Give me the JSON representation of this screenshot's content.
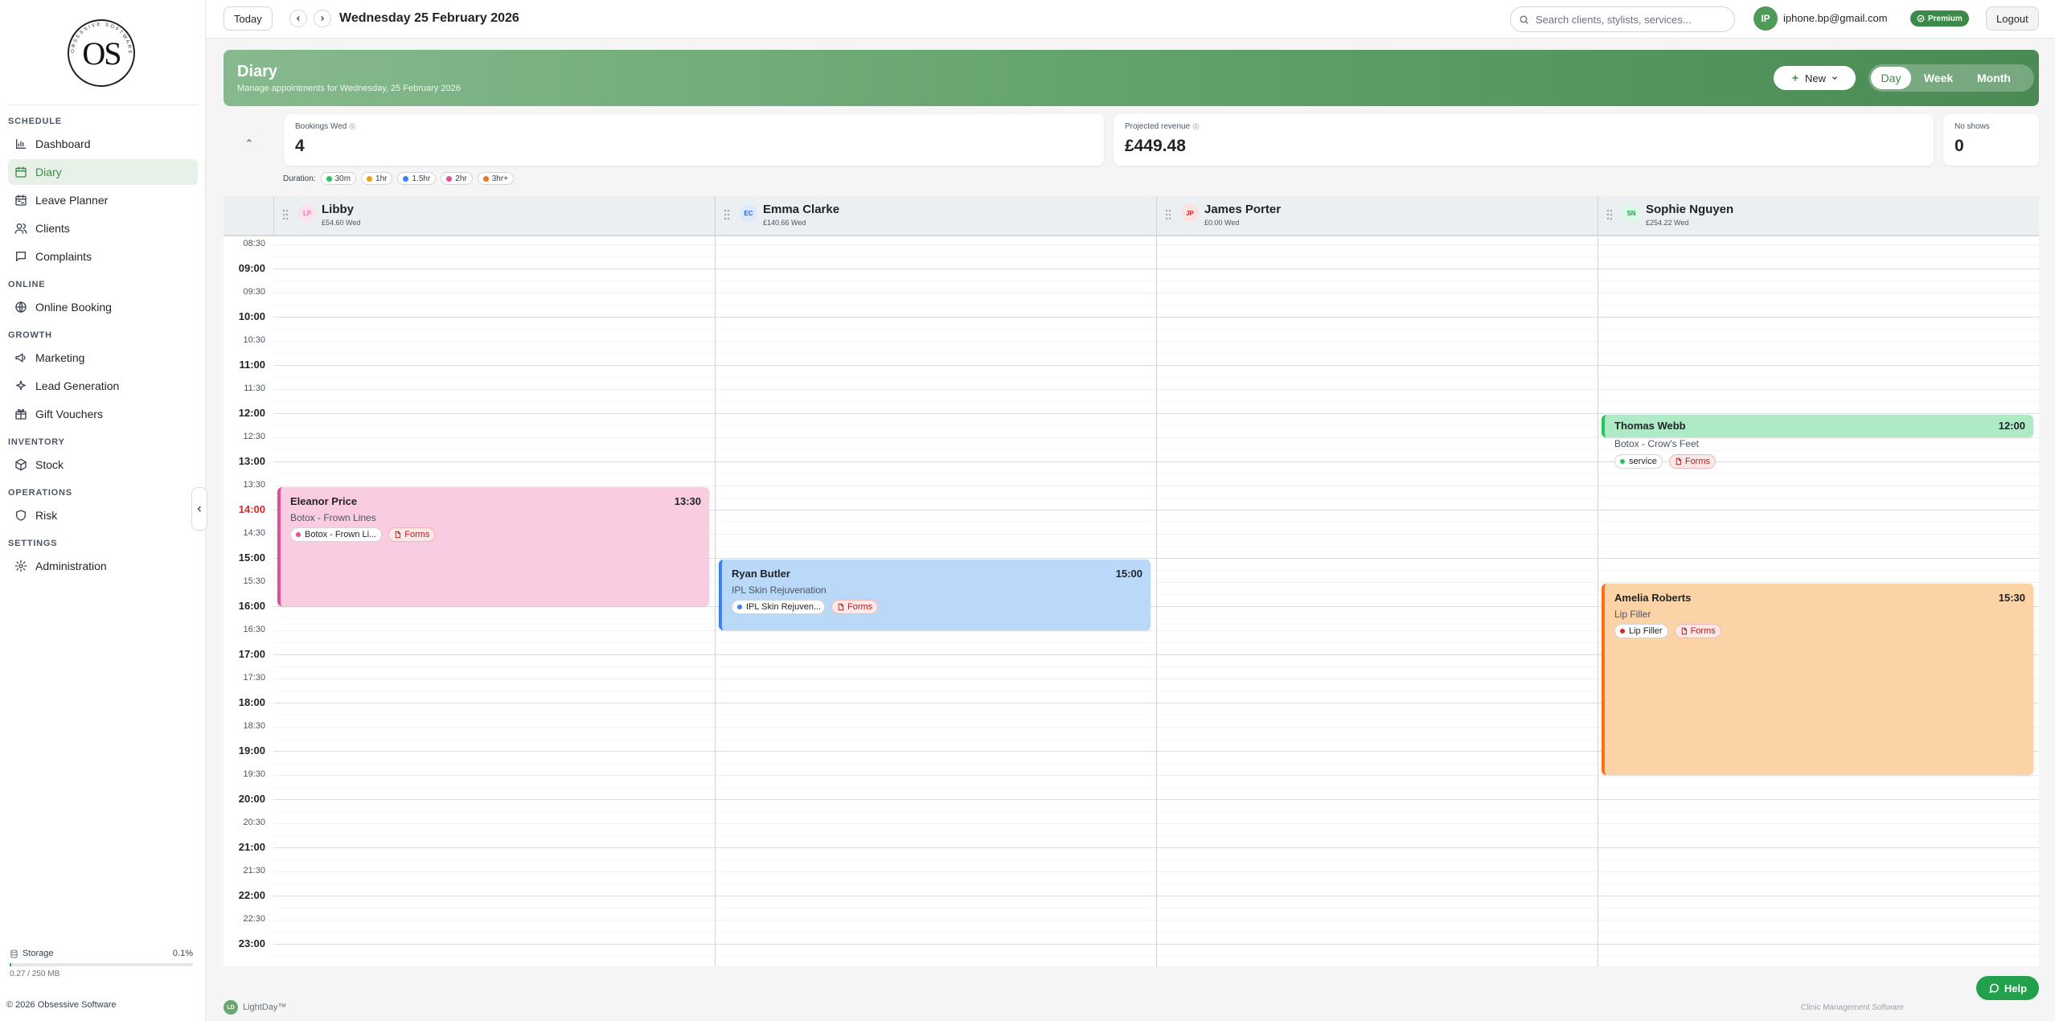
{
  "sidebar": {
    "logo_text": "OS",
    "logo_ring_text": "OBSESSIVE SOFTWARE",
    "sections": [
      {
        "title": "SCHEDULE",
        "items": [
          {
            "label": "Dashboard",
            "icon": "chart-icon"
          },
          {
            "label": "Diary",
            "icon": "calendar-icon",
            "active": true
          },
          {
            "label": "Leave Planner",
            "icon": "calendar-range-icon"
          },
          {
            "label": "Clients",
            "icon": "users-icon"
          },
          {
            "label": "Complaints",
            "icon": "message-icon"
          }
        ]
      },
      {
        "title": "ONLINE",
        "items": [
          {
            "label": "Online Booking",
            "icon": "globe-icon"
          }
        ]
      },
      {
        "title": "GROWTH",
        "items": [
          {
            "label": "Marketing",
            "icon": "megaphone-icon"
          },
          {
            "label": "Lead Generation",
            "icon": "sparkle-icon"
          },
          {
            "label": "Gift Vouchers",
            "icon": "gift-icon"
          }
        ]
      },
      {
        "title": "INVENTORY",
        "items": [
          {
            "label": "Stock",
            "icon": "package-icon"
          }
        ]
      },
      {
        "title": "OPERATIONS",
        "items": [
          {
            "label": "Risk",
            "icon": "shield-icon"
          }
        ]
      },
      {
        "title": "SETTINGS",
        "items": [
          {
            "label": "Administration",
            "icon": "gear-icon"
          }
        ]
      }
    ],
    "storage": {
      "label": "Storage",
      "percent": "0.1%",
      "used": "0.27 / 250 MB",
      "fraction": 0.001
    },
    "copyright": "© 2026 Obsessive Software"
  },
  "topbar": {
    "today_label": "Today",
    "date": "Wednesday 25 February 2026",
    "search_placeholder": "Search clients, stylists, services...",
    "avatar_initials": "IP",
    "email": "iphone.bp@gmail.com",
    "badge": "Premium",
    "logout": "Logout"
  },
  "hero": {
    "title": "Diary",
    "subtitle": "Manage appointments for Wednesday, 25 February 2026",
    "new_label": "New",
    "views": [
      "Day",
      "Week",
      "Month"
    ],
    "active_view": "Day"
  },
  "stats": [
    {
      "label": "Bookings Wed",
      "value": "4"
    },
    {
      "label": "Projected revenue",
      "value": "£449.48"
    },
    {
      "label": "No shows",
      "value": "0"
    }
  ],
  "legend": {
    "label": "Duration:",
    "items": [
      {
        "label": "30m",
        "color": "#22c55e"
      },
      {
        "label": "1hr",
        "color": "#f59e0b"
      },
      {
        "label": "1.5hr",
        "color": "#3b82f6"
      },
      {
        "label": "2hr",
        "color": "#ec4899"
      },
      {
        "label": "3hr+",
        "color": "#f97316"
      }
    ]
  },
  "calendar": {
    "start_hour": 8.5,
    "times": [
      "08:30",
      "09:00",
      "09:30",
      "10:00",
      "10:30",
      "11:00",
      "11:30",
      "12:00",
      "12:30",
      "13:00",
      "13:30",
      "14:00",
      "14:30",
      "15:00",
      "15:30",
      "16:00",
      "16:30",
      "17:00",
      "17:30",
      "18:00",
      "18:30",
      "19:00",
      "19:30",
      "20:00",
      "20:30",
      "21:00",
      "21:30",
      "22:00",
      "22:30",
      "23:00"
    ],
    "current_time_label": "14:00",
    "staff": [
      {
        "initials": "LP",
        "name": "Libby",
        "revenue": "£54.60 Wed",
        "avatar_bg": "#fde2ec",
        "avatar_fg": "#f472b6"
      },
      {
        "initials": "EC",
        "name": "Emma Clarke",
        "revenue": "£140.66 Wed",
        "avatar_bg": "#dbeafe",
        "avatar_fg": "#2563eb"
      },
      {
        "initials": "JP",
        "name": "James Porter",
        "revenue": "£0.00 Wed",
        "avatar_bg": "#fde2e2",
        "avatar_fg": "#dc2626"
      },
      {
        "initials": "SN",
        "name": "Sophie Nguyen",
        "revenue": "£254.22 Wed",
        "avatar_bg": "#dcfce7",
        "avatar_fg": "#16a34a"
      }
    ],
    "appointments": [
      {
        "column": 0,
        "client": "Eleanor Price",
        "time": "13:30",
        "start": 13.5,
        "end": 16.0,
        "service": "Botox - Frown Lines",
        "tag": "Botox - Frown Li...",
        "tag_dot": "#ec4899",
        "forms": "Forms",
        "bg": "#f9cce2",
        "border": "#e0509a"
      },
      {
        "column": 1,
        "client": "Ryan Butler",
        "time": "15:00",
        "start": 15.0,
        "end": 16.5,
        "service": "IPL Skin Rejuvenation",
        "tag": "IPL Skin Rejuven...",
        "tag_dot": "#3b82f6",
        "forms": "Forms",
        "bg": "#bad8f7",
        "border": "#3b82f6"
      },
      {
        "column": 3,
        "client": "Thomas Webb",
        "time": "12:00",
        "start": 12.0,
        "end": 12.5,
        "service": "Botox - Crow's Feet",
        "tag": "service",
        "tag_dot": "#22c55e",
        "forms": "Forms",
        "bg": "#aeeac6",
        "border": "#22c55e"
      },
      {
        "column": 3,
        "client": "Amelia Roberts",
        "time": "15:30",
        "start": 15.5,
        "end": 19.5,
        "service": "Lip Filler",
        "tag": "Lip Filler",
        "tag_dot": "#dc2626",
        "forms": "Forms",
        "bg": "#fcd3a6",
        "border": "#f97316"
      }
    ]
  },
  "footer": {
    "brand": "LightDay™",
    "brand_initials": "LD",
    "tagline": "Clinic Management Software",
    "help": "Help"
  }
}
